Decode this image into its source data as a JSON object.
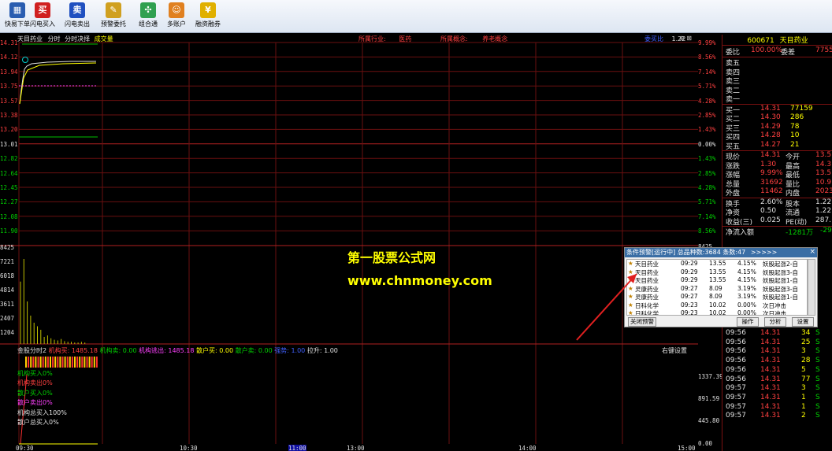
{
  "toolbar": {
    "buttons": [
      {
        "label": "快易下单",
        "icon": "order-icon"
      },
      {
        "label": "闪电买入",
        "icon": "buy-icon",
        "glyph": "买"
      },
      {
        "label": "闪电卖出",
        "icon": "sell-icon",
        "glyph": "卖"
      },
      {
        "label": "预警委托",
        "icon": "alert-order-icon"
      },
      {
        "label": "组合通",
        "icon": "portfolio-icon"
      },
      {
        "label": "多账户",
        "icon": "multi-account-icon"
      },
      {
        "label": "融资融券",
        "icon": "margin-icon"
      }
    ]
  },
  "chart": {
    "stock_name": "天目药业",
    "tabs": [
      "分时",
      "分时决择",
      "成交量"
    ],
    "industry_label": "所属行业:",
    "industry_value": "医药",
    "concept_label": "所属概念:",
    "concept_value": "养老概念",
    "ratio_label": "委买比",
    "ratio_value": "1.22",
    "price_ticks_left": [
      "14.31",
      "14.12",
      "13.94",
      "13.75",
      "13.57",
      "13.38",
      "13.20",
      "13.01",
      "12.82",
      "12.64",
      "12.45",
      "12.27",
      "12.08",
      "11.90"
    ],
    "pct_ticks_right": [
      "9.99%",
      "8.56%",
      "7.14%",
      "5.71%",
      "4.28%",
      "2.85%",
      "1.43%",
      "0.00%",
      "1.43%",
      "2.85%",
      "4.28%",
      "5.71%",
      "7.14%",
      "8.56%"
    ],
    "volume_ticks": [
      "8425",
      "7221",
      "6018",
      "4814",
      "3611",
      "2407",
      "1204"
    ],
    "volume_ticks_right": [
      "8425"
    ],
    "indicator_line": "金股分时2 机构买: 1485.18  机构卖: 0.00  机构逃出: 1485.18  散户买: 0.00  散户卖: 0.00  强势: 1.00  拉升: 1.00",
    "indicator_parts": {
      "name": "金股分时2",
      "inst_buy": "机构买: 1485.18",
      "inst_sell": "机构卖: 0.00",
      "inst_out": "机构逃出: 1485.18",
      "retail_buy": "散户买: 0.00",
      "retail_sell": "散户卖: 0.00",
      "strong": "强势: 1.00",
      "pull": "拉升: 1.00"
    },
    "right_click_setting": "右键设置",
    "legend_lines": [
      "机构买入0%",
      "机构卖出0%",
      "散户买入0%",
      "散户卖出0%",
      "机构总买入100%",
      "散户总买入0%"
    ],
    "lower_ticks_right": [
      "1337.39",
      "891.59",
      "445.80",
      "0.00"
    ],
    "time_labels": [
      "09:30",
      "10:30",
      "11:00",
      "13:00",
      "14:00",
      "15:00"
    ]
  },
  "watermark": {
    "line1": "第一股票公式网",
    "line2": "www.chnmoney.com"
  },
  "quote_panel": {
    "code": "600671",
    "name": "天目药业",
    "weibi_label": "委比",
    "weibi_value": "100.00%",
    "weicha_label": "委差",
    "weicha_value": "7755",
    "sells": [
      {
        "label": "卖五",
        "price": "",
        "vol": ""
      },
      {
        "label": "卖四",
        "price": "",
        "vol": ""
      },
      {
        "label": "卖三",
        "price": "",
        "vol": ""
      },
      {
        "label": "卖二",
        "price": "",
        "vol": ""
      },
      {
        "label": "卖一",
        "price": "",
        "vol": ""
      }
    ],
    "buys": [
      {
        "label": "买一",
        "price": "14.31",
        "vol": "77159"
      },
      {
        "label": "买二",
        "price": "14.30",
        "vol": "286"
      },
      {
        "label": "买三",
        "price": "14.29",
        "vol": "78"
      },
      {
        "label": "买四",
        "price": "14.28",
        "vol": "10"
      },
      {
        "label": "买五",
        "price": "14.27",
        "vol": "21"
      }
    ],
    "stats": [
      {
        "l1": "现价",
        "v1": "14.31",
        "l2": "今开",
        "v2": "13.5"
      },
      {
        "l1": "涨跌",
        "v1": "1.30",
        "l2": "最高",
        "v2": "14.3"
      },
      {
        "l1": "涨幅",
        "v1": "9.99%",
        "l2": "最低",
        "v2": "13.5"
      },
      {
        "l1": "总量",
        "v1": "31692",
        "l2": "量比",
        "v2": "10.9"
      },
      {
        "l1": "外盘",
        "v1": "11462",
        "l2": "内盘",
        "v2": "2023"
      }
    ],
    "stats2": [
      {
        "l1": "换手",
        "v1": "2.60%",
        "l2": "股本",
        "v2": "1.22"
      },
      {
        "l1": "净资",
        "v1": "0.50",
        "l2": "流通",
        "v2": "1.22"
      },
      {
        "l1": "收益(三)",
        "v1": "0.025",
        "l2": "PE(动)",
        "v2": "287."
      }
    ],
    "netflow_label": "净流入额",
    "netflow_value": "-1281万",
    "netflow_value2": "-29",
    "ticks": [
      {
        "time": "09:56",
        "price": "14.31",
        "vol": "34",
        "bs": "S"
      },
      {
        "time": "09:56",
        "price": "14.31",
        "vol": "25",
        "bs": "S"
      },
      {
        "time": "09:56",
        "price": "14.31",
        "vol": "3",
        "bs": "S"
      },
      {
        "time": "09:56",
        "price": "14.31",
        "vol": "28",
        "bs": "S"
      },
      {
        "time": "09:56",
        "price": "14.31",
        "vol": "5",
        "bs": "S"
      },
      {
        "time": "09:56",
        "price": "14.31",
        "vol": "77",
        "bs": "S"
      },
      {
        "time": "09:57",
        "price": "14.31",
        "vol": "3",
        "bs": "S"
      },
      {
        "time": "09:57",
        "price": "14.31",
        "vol": "1",
        "bs": "S"
      },
      {
        "time": "09:57",
        "price": "14.31",
        "vol": "1",
        "bs": "S"
      },
      {
        "time": "09:57",
        "price": "14.31",
        "vol": "2",
        "bs": "S"
      }
    ]
  },
  "popup": {
    "title": "条件预警[运行中] 总品种数:3684 条数:47",
    "arrows": ">>>>>",
    "close_glyph": "×",
    "rows": [
      {
        "name": "天目药业",
        "time": "09:29",
        "price": "13.55",
        "pct": "4.15%",
        "cond": "妖股起涨2-自"
      },
      {
        "name": "天目药业",
        "time": "09:29",
        "price": "13.55",
        "pct": "4.15%",
        "cond": "妖股起涨3-自"
      },
      {
        "name": "天目药业",
        "time": "09:29",
        "price": "13.55",
        "pct": "4.15%",
        "cond": "妖股起涨1-自"
      },
      {
        "name": "灵康药业",
        "time": "09:27",
        "price": "8.09",
        "pct": "3.19%",
        "cond": "妖股起涨3-自"
      },
      {
        "name": "灵康药业",
        "time": "09:27",
        "price": "8.09",
        "pct": "3.19%",
        "cond": "妖股起涨1-自"
      },
      {
        "name": "日科化学",
        "time": "09:23",
        "price": "10.02",
        "pct": "0.00%",
        "cond": "次日冲击"
      },
      {
        "name": "日科化学",
        "time": "09:23",
        "price": "10.02",
        "pct": "0.00%",
        "cond": "次日冲击"
      }
    ],
    "btn_close_alert": "关闭预警",
    "btn_action": "操作",
    "btn_analyze": "分析",
    "btn_settings": "设置"
  }
}
